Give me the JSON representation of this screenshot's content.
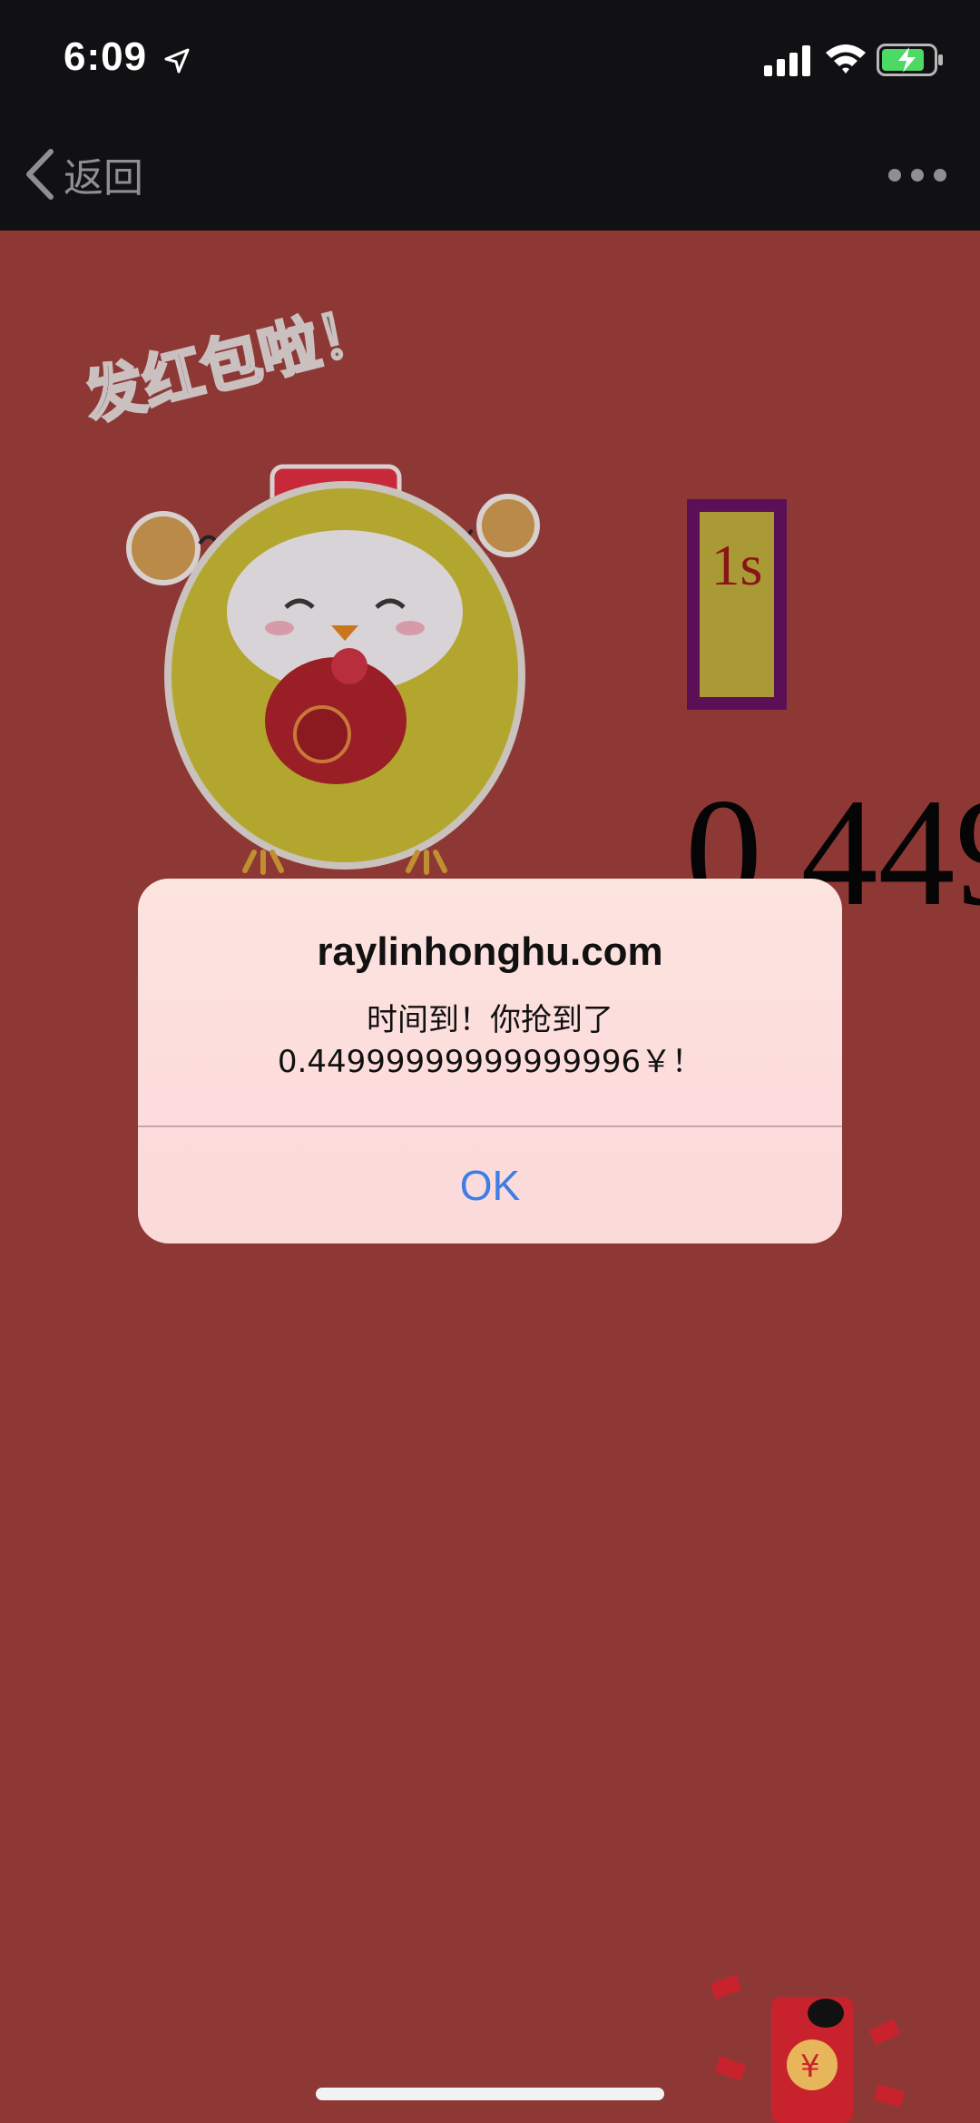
{
  "status_bar": {
    "time": "6:09"
  },
  "nav": {
    "back_label": "返回"
  },
  "page": {
    "banner_text": "发红包啦！",
    "timer_text": "1s",
    "amount_text": "0.449"
  },
  "alert": {
    "title": "raylinhonghu.com",
    "message_line1": "时间到！你抢到了",
    "message_line2": "0.44999999999999996￥！",
    "ok_label": "OK"
  },
  "colors": {
    "page_background": "#8e3836",
    "link_blue": "#3c7de6",
    "battery_green": "#4cd964"
  }
}
